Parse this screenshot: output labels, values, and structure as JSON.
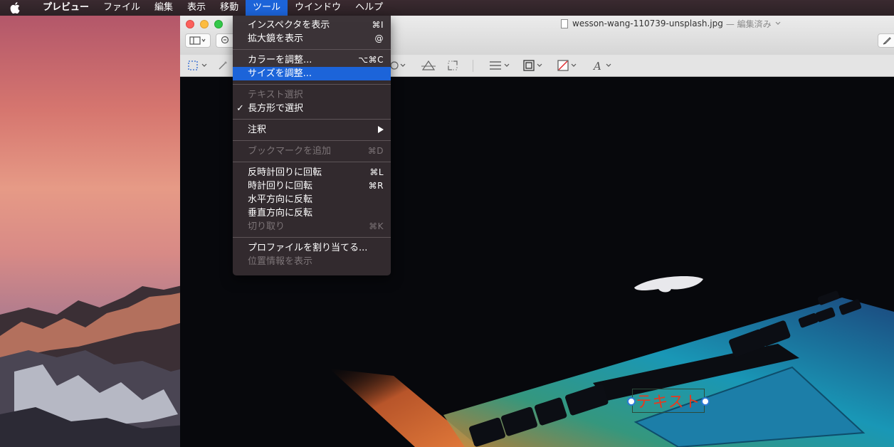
{
  "menubar": {
    "apple_icon": "apple-logo-icon",
    "items": [
      {
        "label": "プレビュー"
      },
      {
        "label": "ファイル"
      },
      {
        "label": "編集"
      },
      {
        "label": "表示"
      },
      {
        "label": "移動"
      },
      {
        "label": "ツール"
      },
      {
        "label": "ウインドウ"
      },
      {
        "label": "ヘルプ"
      }
    ],
    "active_color": "#1c64d9"
  },
  "window": {
    "title": "wesson-wang-110739-unsplash.jpg",
    "title_status": "— 編集済み",
    "annotation_text": "テキスト",
    "annotation_color": "#e8381e"
  },
  "tools_menu": {
    "items": [
      {
        "label": "インスペクタを表示",
        "shortcut": "⌘I",
        "enabled": true
      },
      {
        "label": "拡大鏡を表示",
        "shortcut": "@",
        "enabled": true
      },
      {
        "label": "カラーを調整...",
        "shortcut": "⌥⌘C",
        "enabled": true
      },
      {
        "label": "サイズを調整...",
        "shortcut": "",
        "enabled": true,
        "highlighted": true
      },
      {
        "label": "テキスト選択",
        "shortcut": "",
        "enabled": false
      },
      {
        "label": "長方形で選択",
        "shortcut": "",
        "enabled": true,
        "checked": true
      },
      {
        "label": "注釈",
        "shortcut": "",
        "enabled": true,
        "submenu": true
      },
      {
        "label": "ブックマークを追加",
        "shortcut": "⌘D",
        "enabled": false
      },
      {
        "label": "反時計回りに回転",
        "shortcut": "⌘L",
        "enabled": true
      },
      {
        "label": "時計回りに回転",
        "shortcut": "⌘R",
        "enabled": true
      },
      {
        "label": "水平方向に反転",
        "shortcut": "",
        "enabled": true
      },
      {
        "label": "垂直方向に反転",
        "shortcut": "",
        "enabled": true
      },
      {
        "label": "切り取り",
        "shortcut": "⌘K",
        "enabled": false
      },
      {
        "label": "プロファイルを割り当てる...",
        "shortcut": "",
        "enabled": true
      },
      {
        "label": "位置情報を表示",
        "shortcut": "",
        "enabled": false
      }
    ]
  }
}
